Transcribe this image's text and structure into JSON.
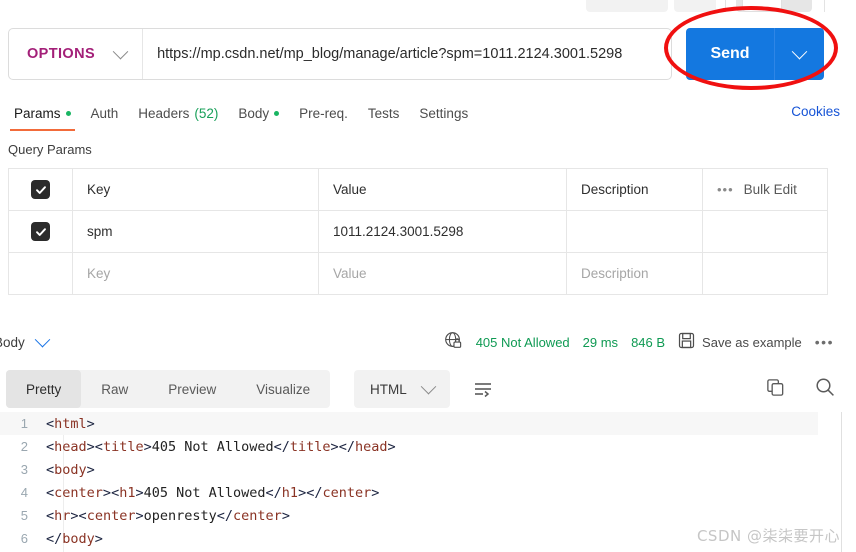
{
  "top_toolbar": {
    "chips": [
      "",
      "",
      "",
      ""
    ]
  },
  "request": {
    "method": "OPTIONS",
    "url": "https://mp.csdn.net/mp_blog/manage/article?spm=1011.2124.3001.5298",
    "send_label": "Send",
    "method_caret_icon": "chevron-down-icon",
    "send_caret_icon": "chevron-down-icon"
  },
  "tabs": [
    {
      "label": "Params",
      "dot": true,
      "active": true
    },
    {
      "label": "Auth",
      "dot": false,
      "active": false
    },
    {
      "label": "Headers",
      "count": "(52)",
      "dot": false,
      "active": false
    },
    {
      "label": "Body",
      "dot": true,
      "active": false
    },
    {
      "label": "Pre-req.",
      "dot": false,
      "active": false
    },
    {
      "label": "Tests",
      "dot": false,
      "active": false
    },
    {
      "label": "Settings",
      "dot": false,
      "active": false
    }
  ],
  "cookies_link": "Cookies",
  "query_params": {
    "title": "Query Params",
    "headers": {
      "key": "Key",
      "value": "Value",
      "description": "Description",
      "bulk_edit": "Bulk Edit",
      "more_icon": "ellipsis-icon"
    },
    "rows": [
      {
        "checked": true,
        "key": "spm",
        "value": "1011.2124.3001.5298",
        "description": ""
      }
    ],
    "placeholder_row": {
      "key": "Key",
      "value": "Value",
      "description": "Description"
    }
  },
  "response": {
    "body_label": "Body",
    "body_caret_icon": "chevron-down-icon",
    "security_icon": "globe-lock-icon",
    "status": "405 Not Allowed",
    "time": "29 ms",
    "size": "846 B",
    "save_icon": "floppy-disk-icon",
    "save_label": "Save as example",
    "more_icon": "ellipsis-icon",
    "status_color": "#0f9a53"
  },
  "viewer": {
    "tabs": [
      "Pretty",
      "Raw",
      "Preview",
      "Visualize"
    ],
    "active_tab": "Pretty",
    "format": "HTML",
    "format_caret_icon": "chevron-down-icon",
    "wrap_icon": "wrap-lines-icon",
    "copy_icon": "copy-icon",
    "search_icon": "search-icon"
  },
  "code": {
    "language": "html",
    "lines": [
      {
        "n": "1",
        "text": "<html>"
      },
      {
        "n": "2",
        "text": "<head><title>405 Not Allowed</title></head>"
      },
      {
        "n": "3",
        "text": "<body>"
      },
      {
        "n": "4",
        "text": "<center><h1>405 Not Allowed</h1></center>"
      },
      {
        "n": "5",
        "text": "<hr><center>openresty</center>"
      },
      {
        "n": "6",
        "text": "</body>"
      }
    ]
  },
  "watermark": "CSDN @柒柒要开心"
}
